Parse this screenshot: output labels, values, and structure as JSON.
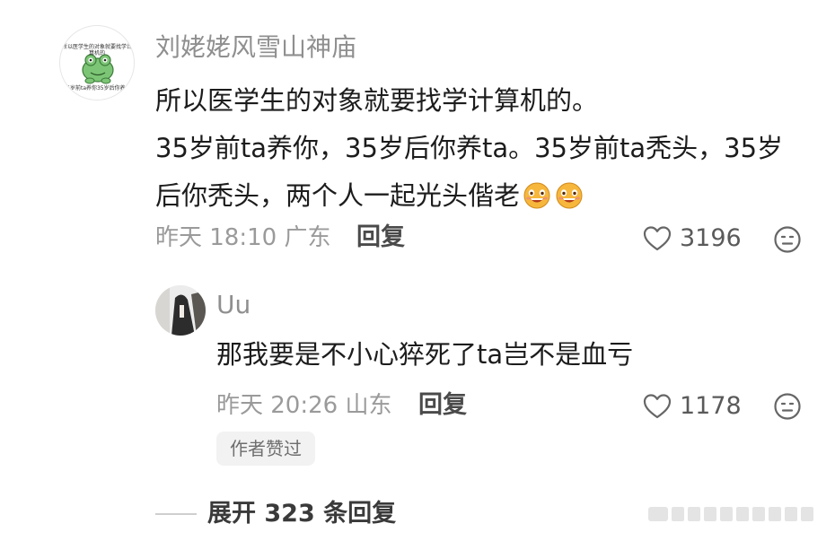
{
  "comment": {
    "username": "刘姥姥风雪山神庙",
    "avatar_caption_top": "所以医学生的对象就要找学计算机的",
    "avatar_caption_bottom": "35岁前ta养你35岁后你养ta",
    "lines": [
      "所以医学生的对象就要找学计算机的。",
      "35岁前ta养你，35岁后你养ta。35岁前ta秃头，35岁",
      "后你秃头，两个人一起光头偕老"
    ],
    "emojis": [
      "grin-emoji",
      "grin-emoji"
    ],
    "time": "昨天 18:10",
    "location": "广东",
    "reply_label": "回复",
    "like_count": "3196"
  },
  "reply": {
    "username": "Uu",
    "text": "那我要是不小心猝死了ta岂不是血亏",
    "time": "昨天 20:26",
    "location": "山东",
    "reply_label": "回复",
    "like_count": "1178",
    "badge": "作者赞过"
  },
  "expand_label": "展开 323 条回复",
  "colors": {
    "emoji_face": "#f6b73c",
    "icon_stroke": "#666666"
  }
}
